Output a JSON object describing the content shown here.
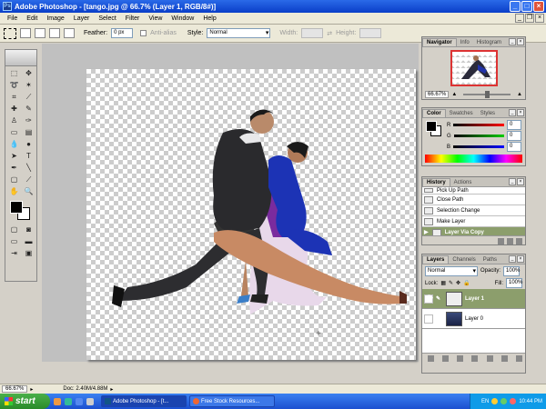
{
  "window": {
    "title": "Adobe Photoshop - [tango.jpg @ 66.7% (Layer 1, RGB/8#)]",
    "app_icon": "Ps"
  },
  "menu": [
    "File",
    "Edit",
    "Image",
    "Layer",
    "Select",
    "Filter",
    "View",
    "Window",
    "Help"
  ],
  "options": {
    "feather_label": "Feather:",
    "feather_value": "0 px",
    "antialias_label": "Anti-alias",
    "style_label": "Style:",
    "style_value": "Normal",
    "width_label": "Width:",
    "height_label": "Height:"
  },
  "navigator": {
    "tabs": [
      "Navigator",
      "Info",
      "Histogram"
    ],
    "zoom": "66.67%"
  },
  "color": {
    "tabs": [
      "Color",
      "Swatches",
      "Styles"
    ],
    "channels": [
      {
        "label": "R",
        "value": "0",
        "color": "#cc0000"
      },
      {
        "label": "G",
        "value": "0",
        "color": "#00aa00"
      },
      {
        "label": "B",
        "value": "0",
        "color": "#0000cc"
      }
    ]
  },
  "history": {
    "tabs": [
      "History",
      "Actions"
    ],
    "items": [
      "Pick Up Path",
      "Close Path",
      "Selection Change",
      "Make Layer",
      "Layer Via Copy"
    ],
    "selected_index": 4
  },
  "layers": {
    "tabs": [
      "Layers",
      "Channels",
      "Paths"
    ],
    "blend_mode": "Normal",
    "opacity_label": "Opacity:",
    "opacity_value": "100%",
    "lock_label": "Lock:",
    "fill_label": "Fill:",
    "fill_value": "100%",
    "items": [
      {
        "name": "Layer 1",
        "selected": true
      },
      {
        "name": "Layer 0",
        "selected": false
      }
    ]
  },
  "status": {
    "zoom": "66.67%",
    "doc": "Doc: 2.40M/4.88M"
  },
  "taskbar": {
    "start": "start",
    "tasks": [
      "Adobe Photoshop - [t...",
      "Free Stock Resources..."
    ],
    "time": "10:44 PM",
    "lang": "EN"
  }
}
